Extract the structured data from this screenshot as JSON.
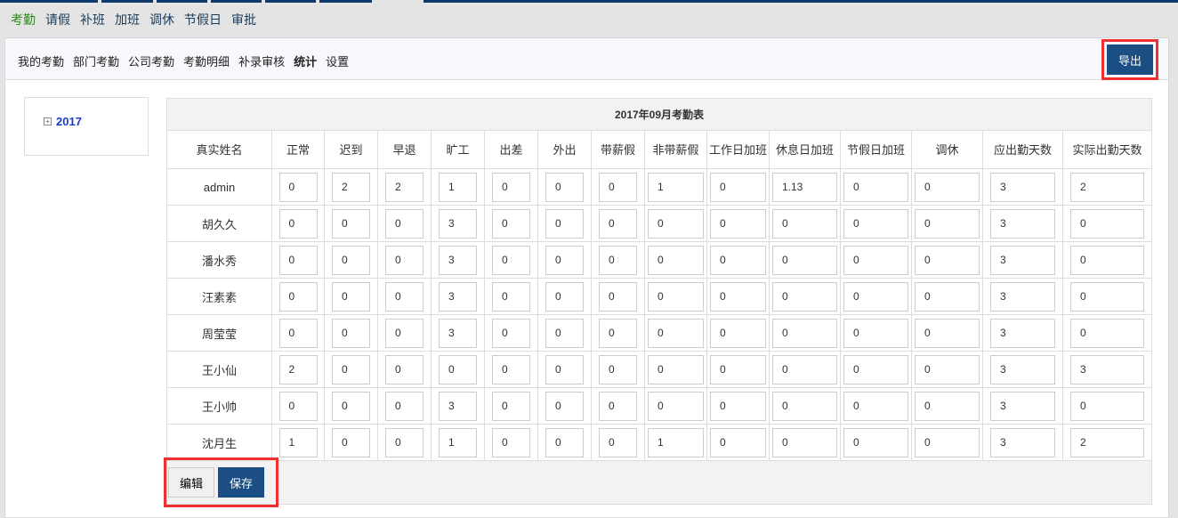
{
  "top_nav": [
    {
      "label": "考勤",
      "active": true
    },
    {
      "label": "请假"
    },
    {
      "label": "补班"
    },
    {
      "label": "加班"
    },
    {
      "label": "调休"
    },
    {
      "label": "节假日"
    },
    {
      "label": "审批"
    }
  ],
  "sub_nav": [
    {
      "label": "我的考勤"
    },
    {
      "label": "部门考勤"
    },
    {
      "label": "公司考勤"
    },
    {
      "label": "考勤明细"
    },
    {
      "label": "补录审核"
    },
    {
      "label": "统计",
      "active": true
    },
    {
      "label": "设置"
    }
  ],
  "export_label": "导出",
  "tree": {
    "year": "2017"
  },
  "table": {
    "title": "2017年09月考勤表",
    "columns": [
      "真实姓名",
      "正常",
      "迟到",
      "早退",
      "旷工",
      "出差",
      "外出",
      "带薪假",
      "非带薪假",
      "工作日加班",
      "休息日加班",
      "节假日加班",
      "调休",
      "应出勤天数",
      "实际出勤天数"
    ],
    "rows": [
      {
        "name": "admin",
        "values": [
          "0",
          "2",
          "2",
          "1",
          "0",
          "0",
          "0",
          "1",
          "0",
          "1.13",
          "0",
          "0",
          "3",
          "2"
        ]
      },
      {
        "name": "胡久久",
        "values": [
          "0",
          "0",
          "0",
          "3",
          "0",
          "0",
          "0",
          "0",
          "0",
          "0",
          "0",
          "0",
          "3",
          "0"
        ]
      },
      {
        "name": "潘水秀",
        "values": [
          "0",
          "0",
          "0",
          "3",
          "0",
          "0",
          "0",
          "0",
          "0",
          "0",
          "0",
          "0",
          "3",
          "0"
        ]
      },
      {
        "name": "汪素素",
        "values": [
          "0",
          "0",
          "0",
          "3",
          "0",
          "0",
          "0",
          "0",
          "0",
          "0",
          "0",
          "0",
          "3",
          "0"
        ]
      },
      {
        "name": "周莹莹",
        "values": [
          "0",
          "0",
          "0",
          "3",
          "0",
          "0",
          "0",
          "0",
          "0",
          "0",
          "0",
          "0",
          "3",
          "0"
        ]
      },
      {
        "name": "王小仙",
        "values": [
          "2",
          "0",
          "0",
          "0",
          "0",
          "0",
          "0",
          "0",
          "0",
          "0",
          "0",
          "0",
          "3",
          "3"
        ]
      },
      {
        "name": "王小帅",
        "values": [
          "0",
          "0",
          "0",
          "3",
          "0",
          "0",
          "0",
          "0",
          "0",
          "0",
          "0",
          "0",
          "3",
          "0"
        ]
      },
      {
        "name": "沈月生",
        "values": [
          "1",
          "0",
          "0",
          "1",
          "0",
          "0",
          "0",
          "1",
          "0",
          "0",
          "0",
          "0",
          "3",
          "2"
        ]
      }
    ]
  },
  "buttons": {
    "edit": "编辑",
    "save": "保存"
  }
}
